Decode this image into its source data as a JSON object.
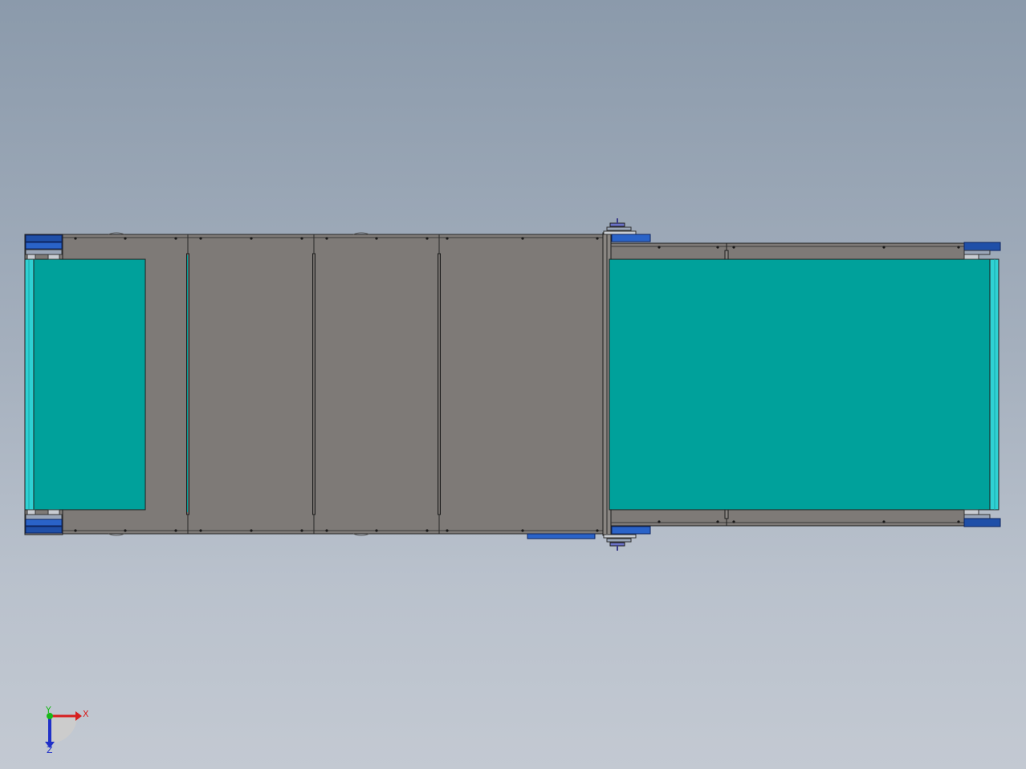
{
  "viewport": {
    "background_top": "#8b9aab",
    "background_bottom": "#c3c9d2"
  },
  "model": {
    "frame_color": "#7e7a77",
    "belt_color": "#00a19b",
    "belt_edge_color": "#2fd1d3",
    "bracket_color": "#1f4fa8",
    "outline_color": "#2a2a2a"
  },
  "triad": {
    "x_label": "X",
    "y_label": "Y",
    "z_label": "Z",
    "x_color": "#d62020",
    "y_color": "#18b818",
    "z_color": "#2030c8",
    "icon": "coordinate-triad-icon"
  }
}
